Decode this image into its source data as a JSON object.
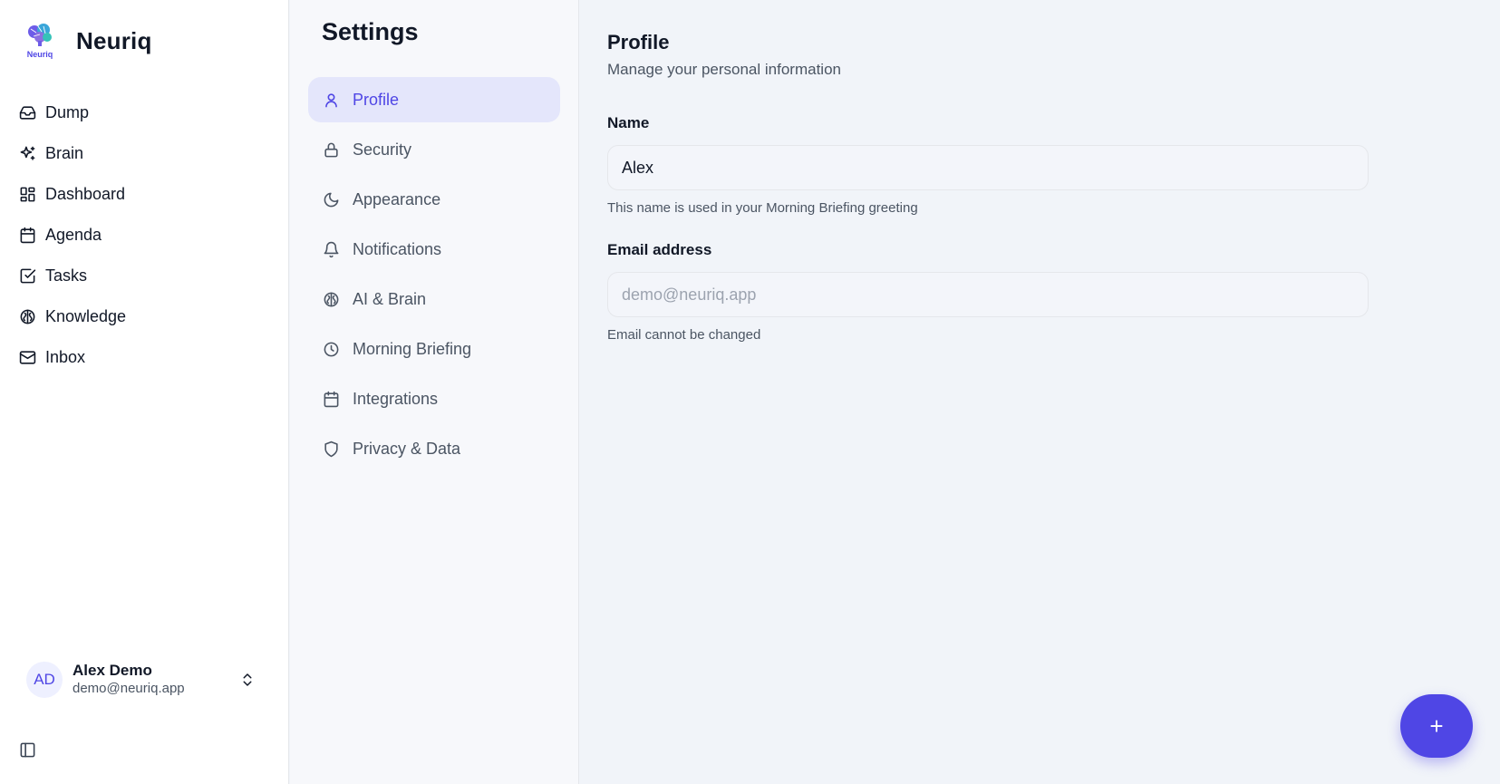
{
  "brand": {
    "name": "Neuriq",
    "logo_text": "Neuriq",
    "logo_icon": "brain-logo-icon"
  },
  "sidebar": {
    "items": [
      {
        "label": "Dump",
        "icon": "inbox-tray-icon"
      },
      {
        "label": "Brain",
        "icon": "sparkles-icon"
      },
      {
        "label": "Dashboard",
        "icon": "grid-layout-icon"
      },
      {
        "label": "Agenda",
        "icon": "calendar-icon"
      },
      {
        "label": "Tasks",
        "icon": "checkbox-icon"
      },
      {
        "label": "Knowledge",
        "icon": "brain-icon"
      },
      {
        "label": "Inbox",
        "icon": "mail-icon"
      }
    ],
    "user": {
      "initials": "AD",
      "name": "Alex Demo",
      "email": "demo@neuriq.app"
    }
  },
  "settings": {
    "title": "Settings",
    "items": [
      {
        "label": "Profile",
        "icon": "user-icon",
        "active": true
      },
      {
        "label": "Security",
        "icon": "lock-icon"
      },
      {
        "label": "Appearance",
        "icon": "moon-icon"
      },
      {
        "label": "Notifications",
        "icon": "bell-icon"
      },
      {
        "label": "AI & Brain",
        "icon": "brain-icon"
      },
      {
        "label": "Morning Briefing",
        "icon": "clock-icon"
      },
      {
        "label": "Integrations",
        "icon": "calendar-icon"
      },
      {
        "label": "Privacy & Data",
        "icon": "shield-icon"
      }
    ]
  },
  "profile": {
    "title": "Profile",
    "subtitle": "Manage your personal information",
    "name_label": "Name",
    "name_value": "Alex",
    "name_help": "This name is used in your Morning Briefing greeting",
    "email_label": "Email address",
    "email_value": "demo@neuriq.app",
    "email_help": "Email cannot be changed"
  },
  "fab": {
    "label": "+"
  },
  "colors": {
    "accent": "#4f46e5",
    "active_bg": "#e4e6fb",
    "main_bg": "#f1f4f9"
  }
}
